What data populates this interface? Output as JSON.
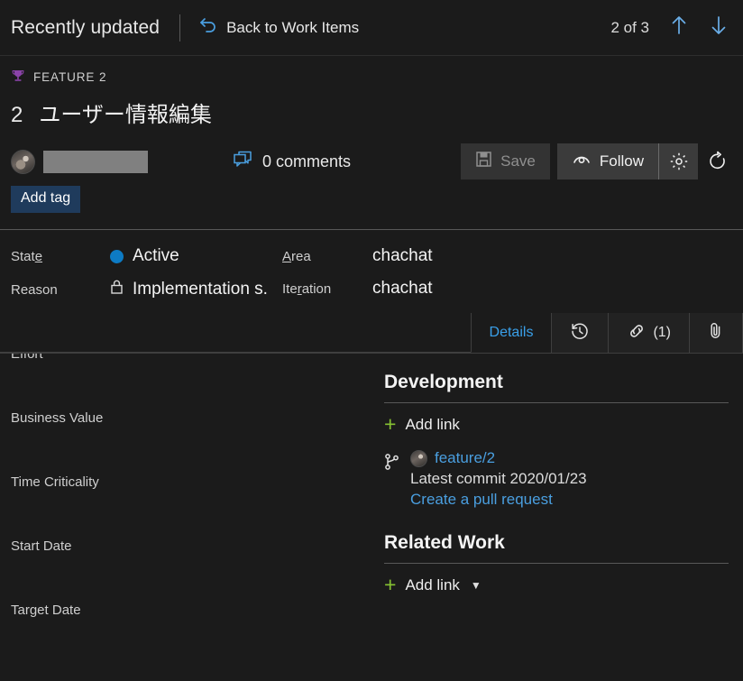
{
  "topbar": {
    "title": "Recently updated",
    "back_label": "Back to Work Items",
    "back_icon": "undo-arrow-icon",
    "counter": "2 of 3",
    "prev_icon": "arrow-up-icon",
    "next_icon": "arrow-down-icon"
  },
  "work_item": {
    "type_label": "FEATURE 2",
    "type_icon": "trophy-icon",
    "id": "2",
    "title": "ユーザー情報編集"
  },
  "toolbar": {
    "assignee_name": "",
    "avatar_icon": "user-avatar",
    "comments_label": "0 comments",
    "comments_icon": "comment-icon",
    "save_label": "Save",
    "save_icon": "save-disk-icon",
    "save_disabled": true,
    "follow_label": "Follow",
    "follow_icon": "eye-icon",
    "settings_icon": "gear-icon",
    "refresh_icon": "refresh-icon",
    "add_tag_label": "Add tag"
  },
  "fields_top": {
    "left": [
      {
        "label_pre": "Stat",
        "label_key": "e",
        "label_post": "",
        "value": "Active",
        "icon": "state-dot"
      },
      {
        "label_pre": "Reason",
        "label_key": "",
        "label_post": "",
        "value": "Implementation s...",
        "icon": "lock-icon"
      }
    ],
    "right": [
      {
        "label_pre": "",
        "label_key": "A",
        "label_post": "rea",
        "value": "chachat"
      },
      {
        "label_pre": "Ite",
        "label_key": "r",
        "label_post": "ation",
        "value": "chachat"
      }
    ]
  },
  "tabs": [
    {
      "label": "Details",
      "icon": "",
      "active": true
    },
    {
      "label": "",
      "icon": "history-icon",
      "active": false
    },
    {
      "label": "(1)",
      "icon": "link-icon",
      "active": false
    },
    {
      "label": "",
      "icon": "paperclip-icon",
      "active": false
    }
  ],
  "left_fields": [
    {
      "label": "Effort"
    },
    {
      "label": "Business Value"
    },
    {
      "label": "Time Criticality"
    },
    {
      "label": "Start Date"
    },
    {
      "label": "Target Date"
    }
  ],
  "development": {
    "title": "Development",
    "add_link_label": "Add link",
    "branch_name": "feature/2",
    "commit_text": "Latest commit 2020/01/23",
    "pull_request_label": "Create a pull request"
  },
  "related_work": {
    "title": "Related Work",
    "add_link_label": "Add link"
  },
  "colors": {
    "accent_link": "#4a9fe0",
    "state_active": "#0d7bc4",
    "feature_purple": "#8a43a8",
    "plus_green": "#86c232",
    "tag_blue": "#1f3b5c",
    "redaction_gray": "#808080"
  }
}
